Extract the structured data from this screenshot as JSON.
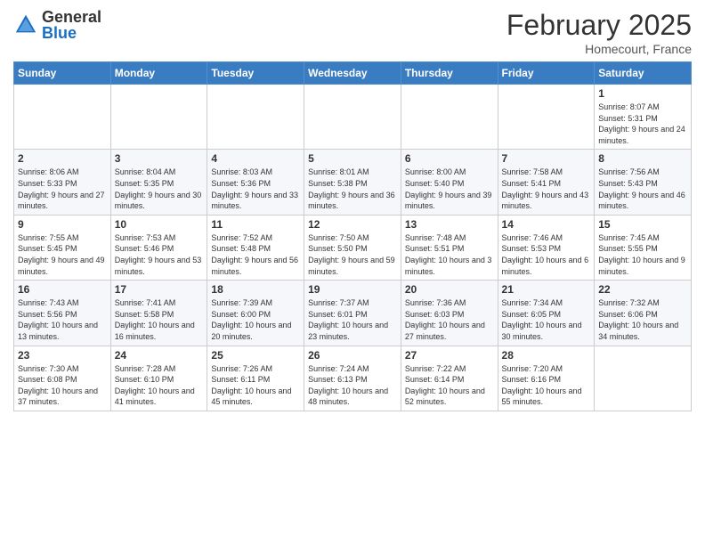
{
  "header": {
    "logo": {
      "general": "General",
      "blue": "Blue"
    },
    "title": "February 2025",
    "location": "Homecourt, France"
  },
  "weekdays": [
    "Sunday",
    "Monday",
    "Tuesday",
    "Wednesday",
    "Thursday",
    "Friday",
    "Saturday"
  ],
  "weeks": [
    [
      {
        "day": "",
        "info": ""
      },
      {
        "day": "",
        "info": ""
      },
      {
        "day": "",
        "info": ""
      },
      {
        "day": "",
        "info": ""
      },
      {
        "day": "",
        "info": ""
      },
      {
        "day": "",
        "info": ""
      },
      {
        "day": "1",
        "info": "Sunrise: 8:07 AM\nSunset: 5:31 PM\nDaylight: 9 hours and 24 minutes."
      }
    ],
    [
      {
        "day": "2",
        "info": "Sunrise: 8:06 AM\nSunset: 5:33 PM\nDaylight: 9 hours and 27 minutes."
      },
      {
        "day": "3",
        "info": "Sunrise: 8:04 AM\nSunset: 5:35 PM\nDaylight: 9 hours and 30 minutes."
      },
      {
        "day": "4",
        "info": "Sunrise: 8:03 AM\nSunset: 5:36 PM\nDaylight: 9 hours and 33 minutes."
      },
      {
        "day": "5",
        "info": "Sunrise: 8:01 AM\nSunset: 5:38 PM\nDaylight: 9 hours and 36 minutes."
      },
      {
        "day": "6",
        "info": "Sunrise: 8:00 AM\nSunset: 5:40 PM\nDaylight: 9 hours and 39 minutes."
      },
      {
        "day": "7",
        "info": "Sunrise: 7:58 AM\nSunset: 5:41 PM\nDaylight: 9 hours and 43 minutes."
      },
      {
        "day": "8",
        "info": "Sunrise: 7:56 AM\nSunset: 5:43 PM\nDaylight: 9 hours and 46 minutes."
      }
    ],
    [
      {
        "day": "9",
        "info": "Sunrise: 7:55 AM\nSunset: 5:45 PM\nDaylight: 9 hours and 49 minutes."
      },
      {
        "day": "10",
        "info": "Sunrise: 7:53 AM\nSunset: 5:46 PM\nDaylight: 9 hours and 53 minutes."
      },
      {
        "day": "11",
        "info": "Sunrise: 7:52 AM\nSunset: 5:48 PM\nDaylight: 9 hours and 56 minutes."
      },
      {
        "day": "12",
        "info": "Sunrise: 7:50 AM\nSunset: 5:50 PM\nDaylight: 9 hours and 59 minutes."
      },
      {
        "day": "13",
        "info": "Sunrise: 7:48 AM\nSunset: 5:51 PM\nDaylight: 10 hours and 3 minutes."
      },
      {
        "day": "14",
        "info": "Sunrise: 7:46 AM\nSunset: 5:53 PM\nDaylight: 10 hours and 6 minutes."
      },
      {
        "day": "15",
        "info": "Sunrise: 7:45 AM\nSunset: 5:55 PM\nDaylight: 10 hours and 9 minutes."
      }
    ],
    [
      {
        "day": "16",
        "info": "Sunrise: 7:43 AM\nSunset: 5:56 PM\nDaylight: 10 hours and 13 minutes."
      },
      {
        "day": "17",
        "info": "Sunrise: 7:41 AM\nSunset: 5:58 PM\nDaylight: 10 hours and 16 minutes."
      },
      {
        "day": "18",
        "info": "Sunrise: 7:39 AM\nSunset: 6:00 PM\nDaylight: 10 hours and 20 minutes."
      },
      {
        "day": "19",
        "info": "Sunrise: 7:37 AM\nSunset: 6:01 PM\nDaylight: 10 hours and 23 minutes."
      },
      {
        "day": "20",
        "info": "Sunrise: 7:36 AM\nSunset: 6:03 PM\nDaylight: 10 hours and 27 minutes."
      },
      {
        "day": "21",
        "info": "Sunrise: 7:34 AM\nSunset: 6:05 PM\nDaylight: 10 hours and 30 minutes."
      },
      {
        "day": "22",
        "info": "Sunrise: 7:32 AM\nSunset: 6:06 PM\nDaylight: 10 hours and 34 minutes."
      }
    ],
    [
      {
        "day": "23",
        "info": "Sunrise: 7:30 AM\nSunset: 6:08 PM\nDaylight: 10 hours and 37 minutes."
      },
      {
        "day": "24",
        "info": "Sunrise: 7:28 AM\nSunset: 6:10 PM\nDaylight: 10 hours and 41 minutes."
      },
      {
        "day": "25",
        "info": "Sunrise: 7:26 AM\nSunset: 6:11 PM\nDaylight: 10 hours and 45 minutes."
      },
      {
        "day": "26",
        "info": "Sunrise: 7:24 AM\nSunset: 6:13 PM\nDaylight: 10 hours and 48 minutes."
      },
      {
        "day": "27",
        "info": "Sunrise: 7:22 AM\nSunset: 6:14 PM\nDaylight: 10 hours and 52 minutes."
      },
      {
        "day": "28",
        "info": "Sunrise: 7:20 AM\nSunset: 6:16 PM\nDaylight: 10 hours and 55 minutes."
      },
      {
        "day": "",
        "info": ""
      }
    ]
  ]
}
